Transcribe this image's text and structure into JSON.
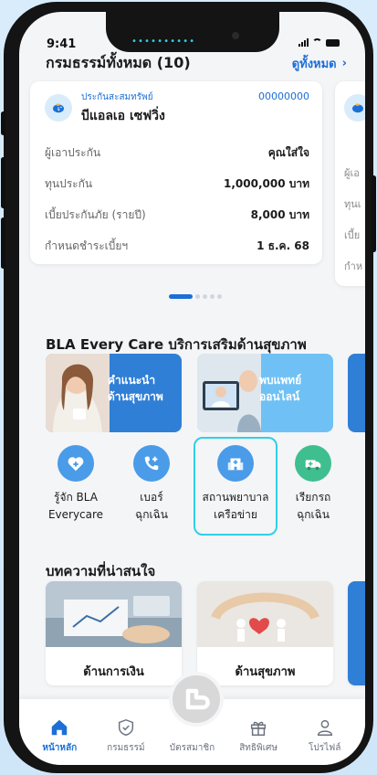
{
  "status": {
    "time": "9:41"
  },
  "policies": {
    "title": "กรมธรรม์ทั้งหมด (10)",
    "see_all": "ดูทั้งหมด",
    "card": {
      "type": "ประกันสะสมทรัพย์",
      "number": "00000000",
      "name": "บีแอลเอ เซฟวิ่ง",
      "rows": [
        {
          "label": "ผู้เอาประกัน",
          "value": "คุณใส่ใจ"
        },
        {
          "label": "ทุนประกัน",
          "value": "1,000,000 บาท"
        },
        {
          "label": "เบี้ยประกันภัย (รายปี)",
          "value": "8,000 บาท"
        },
        {
          "label": "กำหนดชำระเบี้ยฯ",
          "value": "1 ธ.ค. 68"
        }
      ]
    },
    "peek_labels": [
      "ผู้เอ",
      "ทุนเ",
      "เบี้ย",
      "กำห"
    ]
  },
  "care": {
    "title": "BLA Every Care บริการเสริมด้านสุขภาพ",
    "banners": [
      {
        "line1": "คำแนะนำ",
        "line2": "ด้านสุขภาพ"
      },
      {
        "line1": "พบแพทย์",
        "line2": "ออนไลน์"
      }
    ],
    "services": [
      {
        "line1": "รู้จัก BLA",
        "line2": "Everycare",
        "icon": "heart-plus-icon",
        "color": "#4a9be8"
      },
      {
        "line1": "เบอร์",
        "line2": "ฉุกเฉิน",
        "icon": "phone-plus-icon",
        "color": "#4a9be8"
      },
      {
        "line1": "สถานพยาบาล",
        "line2": "เครือข่าย",
        "icon": "hospital-icon",
        "color": "#4a9be8"
      },
      {
        "line1": "เรียกรถ",
        "line2": "ฉุกเฉิน",
        "icon": "ambulance-icon",
        "color": "#3fbf8f"
      }
    ]
  },
  "articles": {
    "title": "บทความที่น่าสนใจ",
    "items": [
      {
        "label": "ด้านการเงิน"
      },
      {
        "label": "ด้านสุขภาพ"
      }
    ]
  },
  "nav": [
    {
      "label": "หน้าหลัก",
      "icon": "home-icon",
      "active": true
    },
    {
      "label": "กรมธรรม์",
      "icon": "shield-icon",
      "active": false
    },
    {
      "label": "บัตรสมาชิก",
      "icon": "member-card-icon",
      "active": false
    },
    {
      "label": "สิทธิพิเศษ",
      "icon": "gift-icon",
      "active": false
    },
    {
      "label": "โปรไฟล์",
      "icon": "profile-icon",
      "active": false
    }
  ],
  "colors": {
    "primary": "#1c6fd6",
    "highlight": "#2fd0e6",
    "green": "#3fbf8f"
  }
}
